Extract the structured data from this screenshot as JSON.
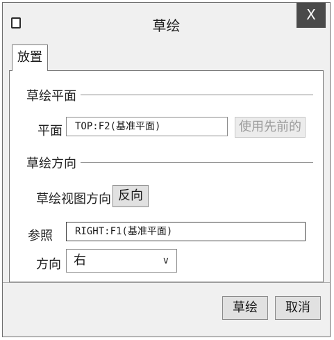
{
  "window": {
    "title": "草绘",
    "close_label": "X"
  },
  "tabs": [
    {
      "label": "放置"
    }
  ],
  "sketch_plane": {
    "group_title": "草绘平面",
    "plane_label": "平面",
    "plane_value": "TOP:F2(基准平面)",
    "use_previous_label": "使用先前的"
  },
  "sketch_orientation": {
    "group_title": "草绘方向",
    "view_direction_label": "草绘视图方向",
    "flip_label": "反向",
    "reference_label": "参照",
    "reference_value": "RIGHT:F1(基准平面)",
    "direction_label": "方向",
    "direction_value": "右"
  },
  "footer": {
    "sketch_button": "草绘",
    "cancel_button": "取消"
  }
}
